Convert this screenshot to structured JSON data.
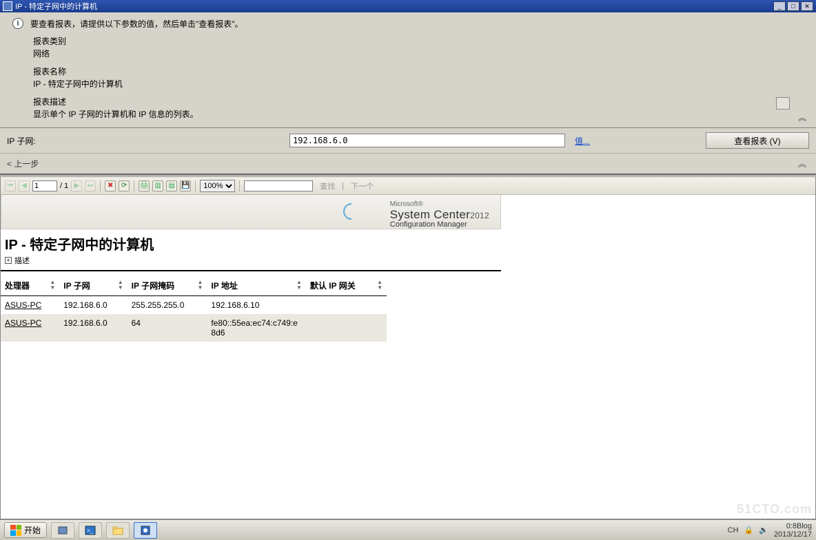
{
  "window": {
    "title": "IP - 特定子网中的计算机"
  },
  "instruction": {
    "prompt": "要查看报表，请提供以下参数的值，然后单击\"查看报表\"。",
    "category_label": "报表类别",
    "category_value": "网络",
    "name_label": "报表名称",
    "name_value": "IP - 特定子网中的计算机",
    "desc_label": "报表描述",
    "desc_value": "显示单个 IP 子网的计算机和 IP 信息的列表。"
  },
  "param": {
    "label": "IP 子网:",
    "value": "192.168.6.0",
    "value_link": "值...",
    "view_button": "查看报表 (V)"
  },
  "nav": {
    "back": "< 上一步"
  },
  "toolbar": {
    "page": "1",
    "pages": "1",
    "of": "/ ",
    "zoom": "100%",
    "find_label": "查找",
    "next_label": "下一个"
  },
  "branding": {
    "ms": "Microsoft®",
    "product": "System Center",
    "year": "2012",
    "sub": "Configuration Manager"
  },
  "report": {
    "title": "IP - 特定子网中的计算机",
    "expand_label": "描述",
    "columns": [
      "处理器",
      "IP 子网",
      "IP 子网掩码",
      "IP 地址",
      "默认 IP 网关"
    ],
    "rows": [
      {
        "host": "ASUS-PC",
        "subnet": "192.168.6.0",
        "mask": "255.255.255.0",
        "ip": "192.168.6.10",
        "gw": ""
      },
      {
        "host": "ASUS-PC",
        "subnet": "192.168.6.0",
        "mask": "64",
        "ip": "fe80::55ea:ec74:c749:e8d6",
        "gw": ""
      }
    ]
  },
  "taskbar": {
    "start": "开始",
    "lang": "CH",
    "time1": "0:8Blog",
    "date": "2013/12/17",
    "wm1": "51CTO.com",
    "wm2": "P技术博客"
  }
}
